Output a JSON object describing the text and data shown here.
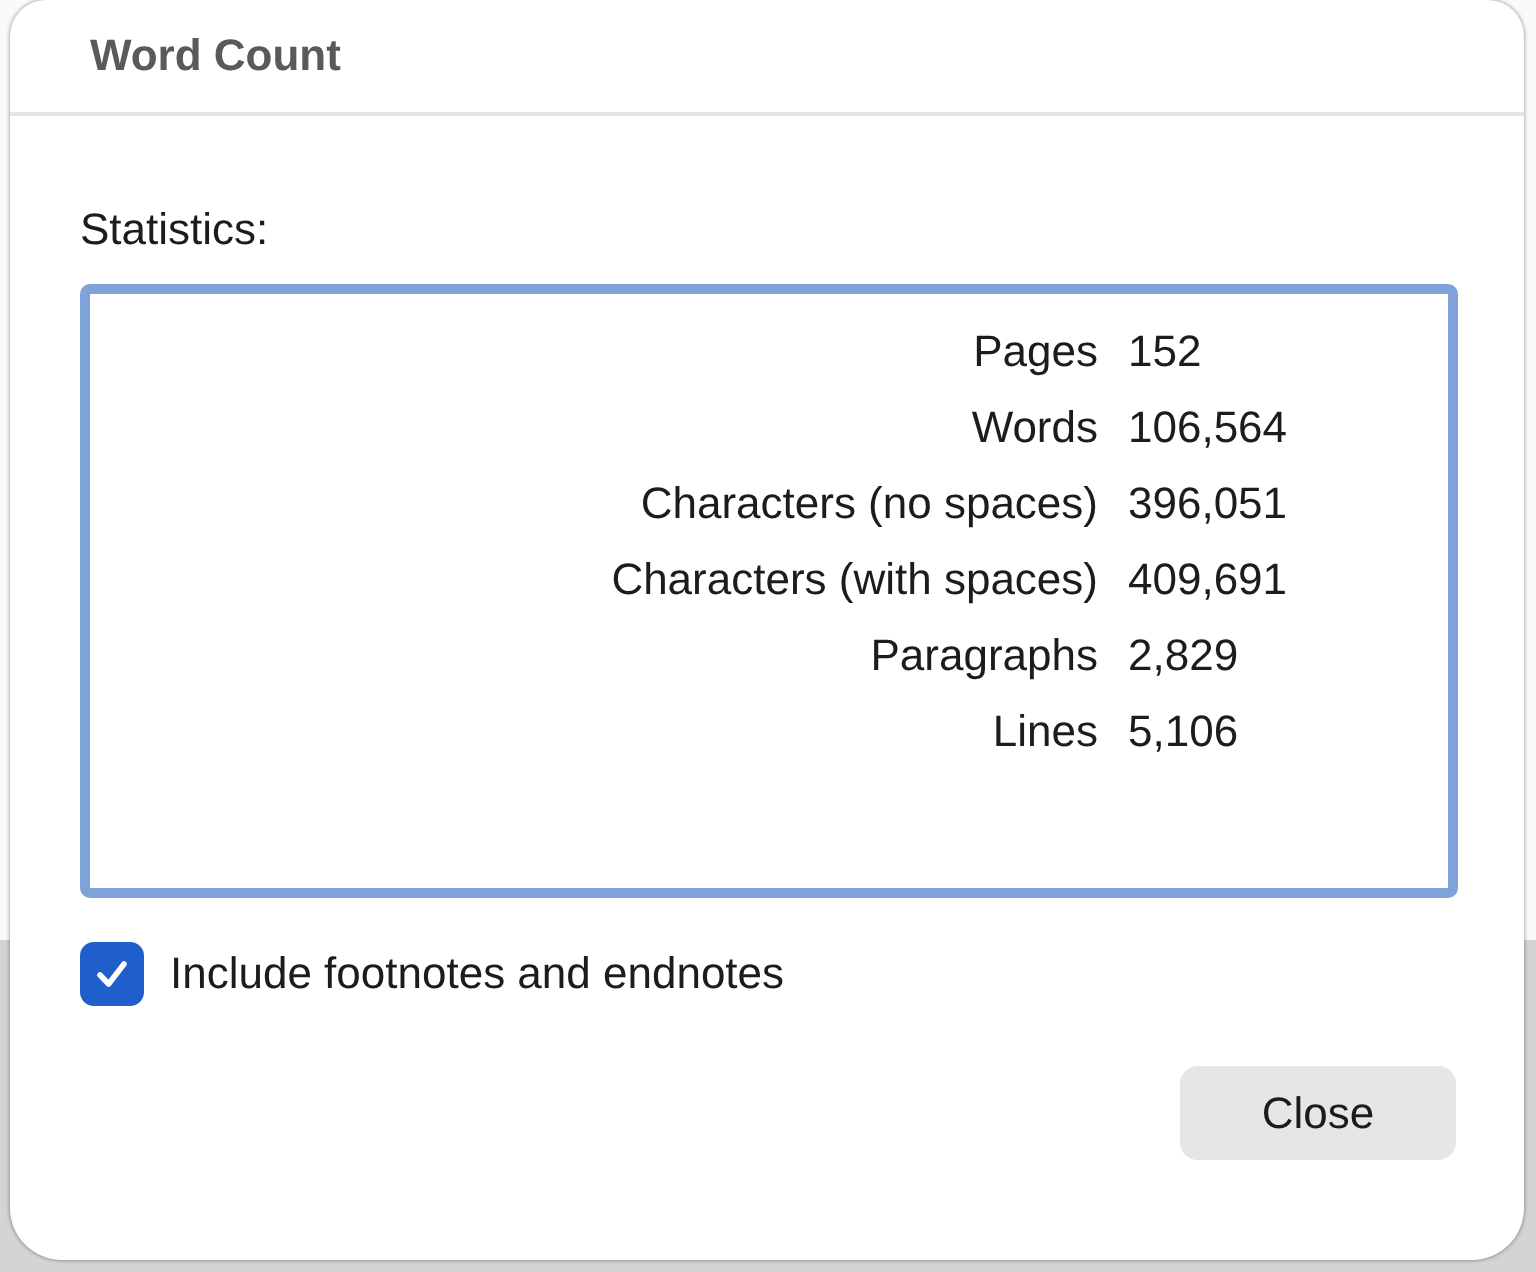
{
  "window": {
    "title": "Word Count"
  },
  "statistics": {
    "label": "Statistics:",
    "rows": [
      {
        "label": "Pages",
        "value": "152"
      },
      {
        "label": "Words",
        "value": "106,564"
      },
      {
        "label": "Characters (no spaces)",
        "value": "396,051"
      },
      {
        "label": "Characters (with spaces)",
        "value": "409,691"
      },
      {
        "label": "Paragraphs",
        "value": "2,829"
      },
      {
        "label": "Lines",
        "value": "5,106"
      }
    ]
  },
  "include_notes": {
    "label": "Include footnotes and endnotes",
    "checked": true
  },
  "buttons": [
    {
      "label": "Close"
    }
  ]
}
